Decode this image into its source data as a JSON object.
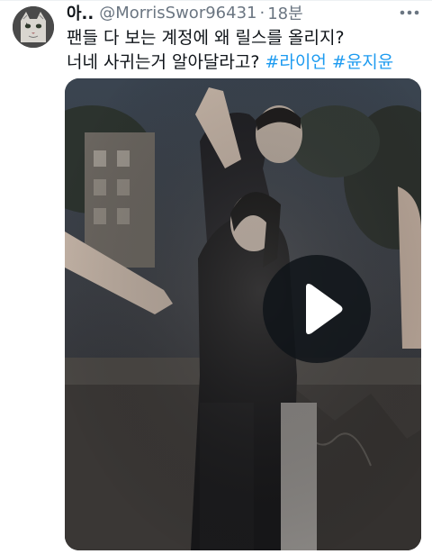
{
  "tweet": {
    "display_name": "아..",
    "handle": "@MorrisSwor96431",
    "separator": "·",
    "time": "18분",
    "text_line1": "팬들 다 보는 계정에 왜 릴스를 올리지?",
    "text_line2": "너네 사귀는거 알아달라고? ",
    "hashtags": [
      "#라이언",
      "#윤지윤"
    ]
  },
  "media": {
    "type": "video",
    "play_icon": "play-icon"
  },
  "icons": {
    "avatar": "cat-avatar",
    "more": "more-options-icon"
  },
  "colors": {
    "link": "#1d9bf0",
    "text": "#0f1419",
    "secondary": "#6b7682"
  }
}
